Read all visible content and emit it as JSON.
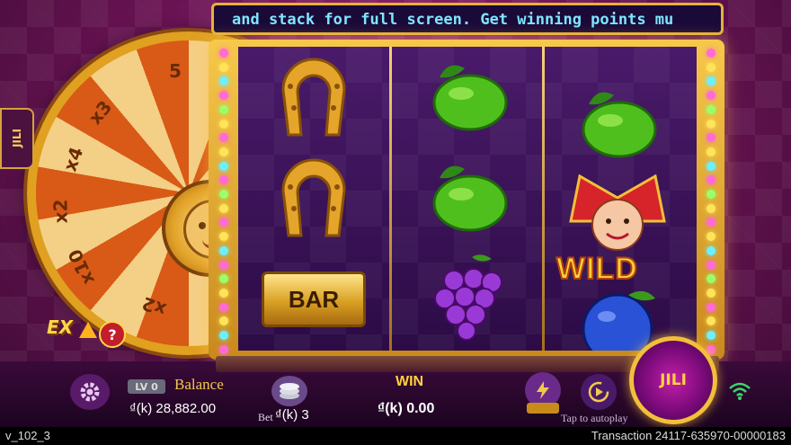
{
  "ticker": {
    "text": "and stack for full screen. Get winning points mu"
  },
  "jili_tab": {
    "label": "JILI"
  },
  "wheel": {
    "multipliers": [
      "5",
      "x3",
      "x4",
      "x2",
      "x10",
      "x2"
    ]
  },
  "ex_badge": {
    "label": "EX",
    "help": "?"
  },
  "reels": {
    "columns": [
      {
        "symbols": [
          "horseshoe",
          "horseshoe",
          "bar"
        ]
      },
      {
        "symbols": [
          "lime",
          "lime",
          "grapes"
        ]
      },
      {
        "symbols": [
          "lime",
          "wild",
          "plum"
        ]
      }
    ],
    "bar_label": "BAR",
    "wild_label": "WILD"
  },
  "bottom": {
    "level": "LV 0",
    "balance_label": "Balance",
    "balance_value": "₫(k) 28,882.00",
    "bet_label": "Bet",
    "bet_value": "₫(k) 3",
    "win_label": "WIN",
    "win_value": "₫(k) 0.00",
    "autoplay_hint": "Tap to autoplay",
    "spin_label": "JILI"
  },
  "footer": {
    "version": "v_102_3",
    "transaction": "Transaction 24117-635970-00000183"
  },
  "colors": {
    "accent_gold": "#f2bf3a",
    "ticker_text": "#7fe6ff",
    "background": "#6e1456"
  }
}
